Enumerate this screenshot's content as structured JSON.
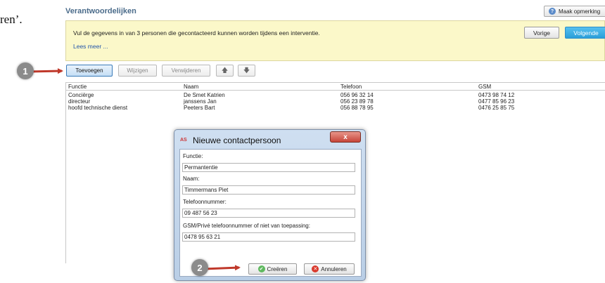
{
  "document": {
    "fragment": "ren’."
  },
  "header": {
    "title": "Verantwoordelijken",
    "remark_button": "Maak opmerking"
  },
  "info": {
    "text": "Vul de gegevens in van 3 personen die gecontacteerd kunnen worden tijdens een interventie.",
    "more_link": "Lees meer ...",
    "prev_label": "Vorige",
    "next_label": "Volgende"
  },
  "toolbar": {
    "add": "Toevoegen",
    "edit": "Wijzigen",
    "delete": "Verwijderen",
    "up": "🡅",
    "down": "🡇"
  },
  "table": {
    "columns": [
      "Functie",
      "Naam",
      "Telefoon",
      "GSM"
    ],
    "rows": [
      [
        "Conciërge",
        "De Smet Katrien",
        "056 96 32 14",
        "0473 98 74 12"
      ],
      [
        "directeur",
        "janssens Jan",
        "056 23 89 78",
        "0477 85 96 23"
      ],
      [
        "hoofd technische dienst",
        "Peeters Bart",
        "056 88 78 95",
        "0476 25 85 75"
      ]
    ]
  },
  "dialog": {
    "logo": "AS",
    "title": "Nieuwe contactpersoon",
    "close": "x",
    "fields": [
      {
        "label": "Functie:",
        "value": "Permantentie"
      },
      {
        "label": "Naam:",
        "value": "Timmermans Piet"
      },
      {
        "label": "Telefoonnummer:",
        "value": "09 487 56 23"
      },
      {
        "label": "GSM/Privé telefoonnummer of niet van toepassing:",
        "value": "0478 95 63 21"
      }
    ],
    "create": "Creëren",
    "cancel": "Annuleren"
  },
  "annotations": {
    "step1": "1",
    "step2": "2",
    "arrow_color": "#c0392b"
  },
  "colors": {
    "accent": "#2b9fd9",
    "info_bg": "#fbf8c9"
  }
}
